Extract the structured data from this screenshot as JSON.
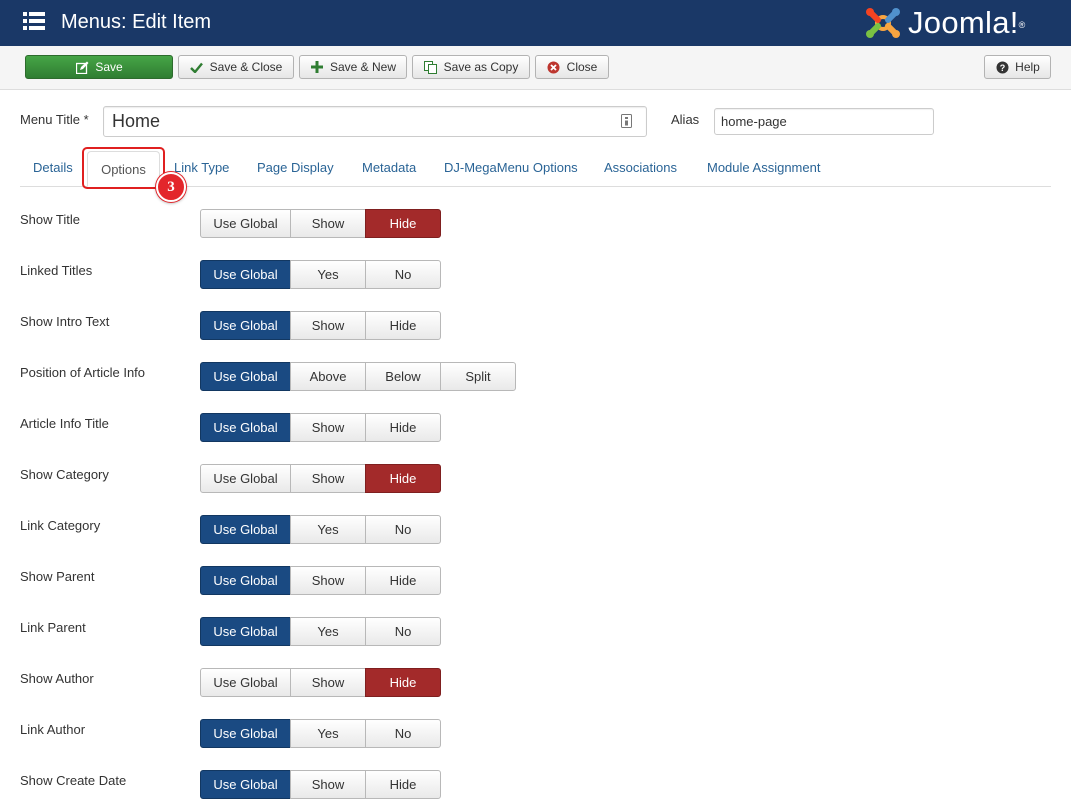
{
  "header": {
    "title": "Menus: Edit Item",
    "brand": "Joomla!",
    "brand_color": "#1a3867"
  },
  "toolbar": {
    "save": "Save",
    "save_close": "Save & Close",
    "save_new": "Save & New",
    "save_copy": "Save as Copy",
    "close": "Close",
    "help": "Help"
  },
  "form": {
    "menu_title_label": "Menu Title *",
    "menu_title_value": "Home",
    "alias_label": "Alias",
    "alias_value": "home-page"
  },
  "tabs": [
    {
      "label": "Details"
    },
    {
      "label": "Options",
      "active": true
    },
    {
      "label": "Link Type"
    },
    {
      "label": "Page Display"
    },
    {
      "label": "Metadata"
    },
    {
      "label": "DJ-MegaMenu Options"
    },
    {
      "label": "Associations"
    },
    {
      "label": "Module Assignment"
    }
  ],
  "annotation": {
    "step": "3"
  },
  "options": [
    {
      "label": "Show Title",
      "buttons": [
        "Use Global",
        "Show",
        "Hide"
      ],
      "selected": "Hide"
    },
    {
      "label": "Linked Titles",
      "buttons": [
        "Use Global",
        "Yes",
        "No"
      ],
      "selected": "Use Global"
    },
    {
      "label": "Show Intro Text",
      "buttons": [
        "Use Global",
        "Show",
        "Hide"
      ],
      "selected": "Use Global"
    },
    {
      "label": "Position of Article Info",
      "buttons": [
        "Use Global",
        "Above",
        "Below",
        "Split"
      ],
      "selected": "Use Global"
    },
    {
      "label": "Article Info Title",
      "buttons": [
        "Use Global",
        "Show",
        "Hide"
      ],
      "selected": "Use Global"
    },
    {
      "label": "Show Category",
      "buttons": [
        "Use Global",
        "Show",
        "Hide"
      ],
      "selected": "Hide"
    },
    {
      "label": "Link Category",
      "buttons": [
        "Use Global",
        "Yes",
        "No"
      ],
      "selected": "Use Global"
    },
    {
      "label": "Show Parent",
      "buttons": [
        "Use Global",
        "Show",
        "Hide"
      ],
      "selected": "Use Global"
    },
    {
      "label": "Link Parent",
      "buttons": [
        "Use Global",
        "Yes",
        "No"
      ],
      "selected": "Use Global"
    },
    {
      "label": "Show Author",
      "buttons": [
        "Use Global",
        "Show",
        "Hide"
      ],
      "selected": "Hide"
    },
    {
      "label": "Link Author",
      "buttons": [
        "Use Global",
        "Yes",
        "No"
      ],
      "selected": "Use Global"
    },
    {
      "label": "Show Create Date",
      "buttons": [
        "Use Global",
        "Show",
        "Hide"
      ],
      "selected": "Use Global"
    }
  ],
  "colors": {
    "active_global": "#1a4a82",
    "active_hide": "#a32a2a",
    "save_green": "#3a963a"
  }
}
